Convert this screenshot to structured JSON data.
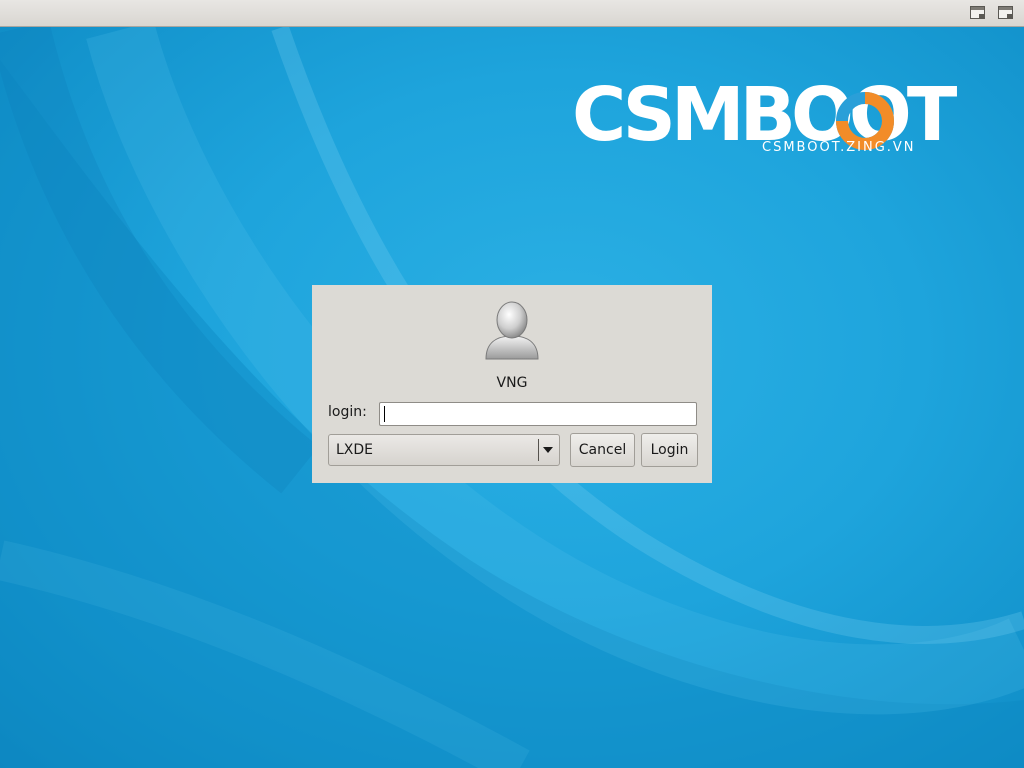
{
  "topbar": {
    "tray_icons": [
      "window-icon",
      "window-icon"
    ]
  },
  "branding": {
    "wordmark": "CSMBOOT",
    "subtitle": "CSMBOOT.ZING.VN",
    "ring_colors": [
      "#f28c28",
      "#2a9fd8"
    ]
  },
  "login_dialog": {
    "avatar_icon": "user-avatar-icon",
    "username": "VNG",
    "login_label": "login:",
    "login_value": "",
    "session": {
      "selected": "LXDE"
    },
    "cancel_label": "Cancel",
    "login_button_label": "Login"
  },
  "theme": {
    "wallpaper": "#1ea4dc",
    "dialog_bg": "#dcdad5",
    "topbar_bg": "#dedbd6"
  }
}
